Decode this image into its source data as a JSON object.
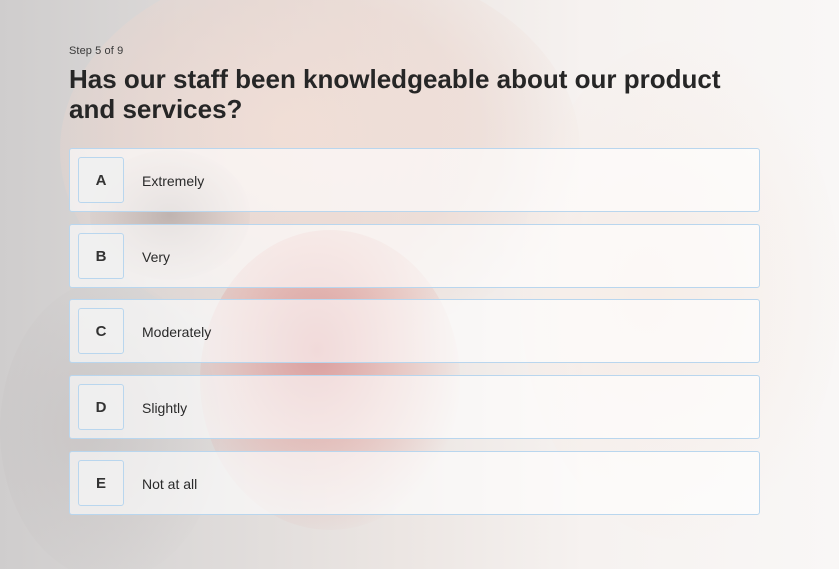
{
  "step": "Step 5 of 9",
  "question": "Has our staff been knowledgeable about our product and services?",
  "options": [
    {
      "key": "A",
      "label": "Extremely"
    },
    {
      "key": "B",
      "label": "Very"
    },
    {
      "key": "C",
      "label": "Moderately"
    },
    {
      "key": "D",
      "label": "Slightly"
    },
    {
      "key": "E",
      "label": "Not at all"
    }
  ],
  "colors": {
    "option_border": "#b9d6ee",
    "text": "#262626"
  }
}
